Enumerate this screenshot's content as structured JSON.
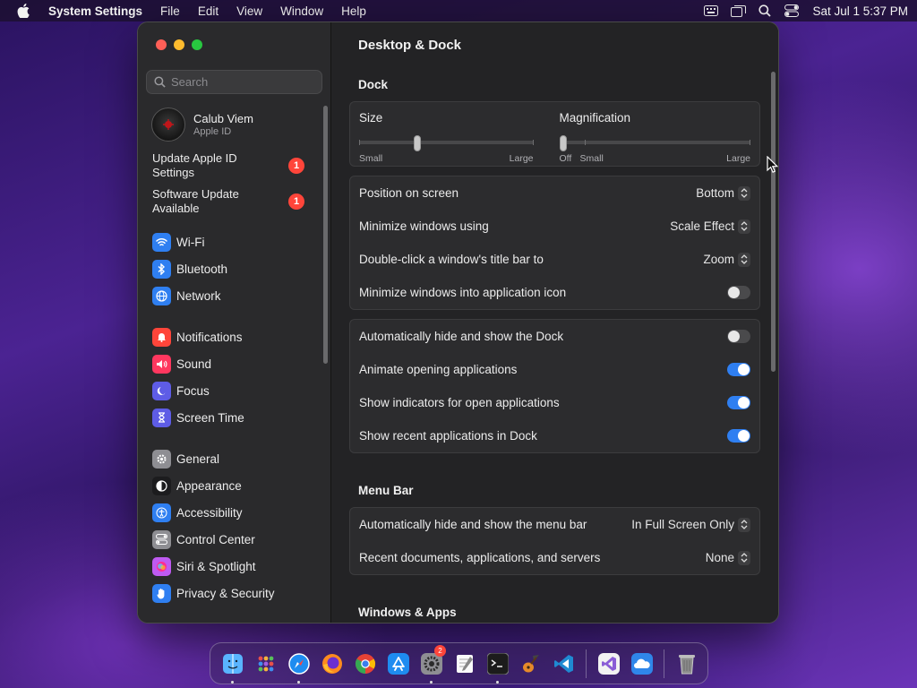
{
  "menubar": {
    "app_name": "System Settings",
    "menus": [
      "File",
      "Edit",
      "View",
      "Window",
      "Help"
    ],
    "clock": "Sat Jul 1  5:37 PM",
    "status_icons": [
      "keyboard-icon",
      "screen-mirror-icon",
      "spotlight-search-icon",
      "control-center-icon"
    ]
  },
  "sidebar": {
    "search_placeholder": "Search",
    "account": {
      "name": "Calub Viem",
      "subtitle": "Apple ID"
    },
    "notices": [
      {
        "label": "Update Apple ID Settings",
        "badge": "1"
      },
      {
        "label": "Software Update Available",
        "badge": "1"
      }
    ],
    "groups": [
      [
        {
          "label": "Wi-Fi",
          "icon": "wifi-icon",
          "color": "#2f7ff1"
        },
        {
          "label": "Bluetooth",
          "icon": "bluetooth-icon",
          "color": "#2f7ff1"
        },
        {
          "label": "Network",
          "icon": "globe-icon",
          "color": "#2f7ff1"
        }
      ],
      [
        {
          "label": "Notifications",
          "icon": "bell-icon",
          "color": "#ff453a"
        },
        {
          "label": "Sound",
          "icon": "speaker-icon",
          "color": "#ff375f"
        },
        {
          "label": "Focus",
          "icon": "moon-icon",
          "color": "#5e5ce6"
        },
        {
          "label": "Screen Time",
          "icon": "hourglass-icon",
          "color": "#5e5ce6"
        }
      ],
      [
        {
          "label": "General",
          "icon": "gear-icon",
          "color": "#8e8e93"
        },
        {
          "label": "Appearance",
          "icon": "appearance-icon",
          "color": "#1c1c1e"
        },
        {
          "label": "Accessibility",
          "icon": "accessibility-icon",
          "color": "#2f7ff1"
        },
        {
          "label": "Control Center",
          "icon": "control-center-icon",
          "color": "#8e8e93"
        },
        {
          "label": "Siri & Spotlight",
          "icon": "siri-icon",
          "color": "#bf5af2"
        },
        {
          "label": "Privacy & Security",
          "icon": "hand-icon",
          "color": "#2f7ff1"
        }
      ]
    ]
  },
  "content": {
    "title": "Desktop & Dock",
    "dock_section": {
      "title": "Dock",
      "size": {
        "label": "Size",
        "min_label": "Small",
        "max_label": "Large",
        "value": 0.18
      },
      "magnification": {
        "label": "Magnification",
        "off_label": "Off",
        "min_label": "Small",
        "max_label": "Large",
        "value": 0.0
      },
      "selects": [
        {
          "label": "Position on screen",
          "value": "Bottom"
        },
        {
          "label": "Minimize windows using",
          "value": "Scale Effect"
        },
        {
          "label": "Double-click a window's title bar to",
          "value": "Zoom"
        }
      ],
      "minimize_into_icon": {
        "label": "Minimize windows into application icon",
        "on": false
      },
      "toggles": [
        {
          "label": "Automatically hide and show the Dock",
          "on": false
        },
        {
          "label": "Animate opening applications",
          "on": true
        },
        {
          "label": "Show indicators for open applications",
          "on": true
        },
        {
          "label": "Show recent applications in Dock",
          "on": true
        }
      ]
    },
    "menubar_section": {
      "title": "Menu Bar",
      "selects": [
        {
          "label": "Automatically hide and show the menu bar",
          "value": "In Full Screen Only"
        },
        {
          "label": "Recent documents, applications, and servers",
          "value": "None"
        }
      ]
    },
    "windows_section": {
      "title": "Windows & Apps"
    }
  },
  "dock": {
    "apps": [
      {
        "name": "finder-icon",
        "color": "#3d9bf0",
        "running": true
      },
      {
        "name": "launchpad-icon",
        "color": "#c9c9cf",
        "running": false
      },
      {
        "name": "safari-icon",
        "color": "#2a86e8",
        "running": true
      },
      {
        "name": "firefox-icon",
        "color": "#ff7a1a",
        "running": false
      },
      {
        "name": "chrome-icon",
        "color": "#e8e8e8",
        "running": false
      },
      {
        "name": "app-store-icon",
        "color": "#1e8cf0",
        "running": false
      },
      {
        "name": "system-settings-icon",
        "color": "#8e8e93",
        "running": true,
        "badge": "2"
      },
      {
        "name": "textedit-icon",
        "color": "#f2f2f2",
        "running": false
      },
      {
        "name": "terminal-icon",
        "color": "#1a1a1a",
        "running": true
      },
      {
        "name": "garageband-icon",
        "color": "#f49a2a",
        "running": false
      },
      {
        "name": "vscode-icon",
        "color": "#1f8ad2",
        "running": false
      }
    ],
    "recent_apps": [
      {
        "name": "visual-studio-icon",
        "color": "#8a5cd6",
        "running": false
      },
      {
        "name": "icloud-icon",
        "color": "#2f86ea",
        "running": false
      }
    ],
    "trash": {
      "name": "trash-icon",
      "color": "#9a9a9a"
    }
  }
}
